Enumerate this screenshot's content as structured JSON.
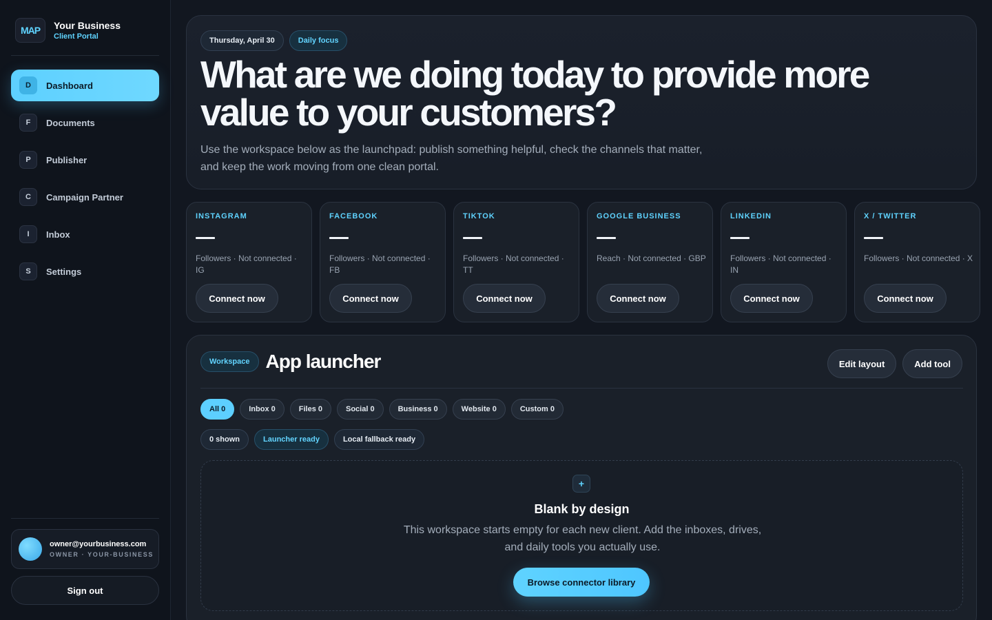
{
  "brand": {
    "logo_text": "MAP",
    "title": "Your Business",
    "subtitle": "Client Portal"
  },
  "sidebar": {
    "items": [
      {
        "letter": "D",
        "label": "Dashboard",
        "active": true
      },
      {
        "letter": "F",
        "label": "Documents"
      },
      {
        "letter": "P",
        "label": "Publisher"
      },
      {
        "letter": "C",
        "label": "Campaign Partner"
      },
      {
        "letter": "I",
        "label": "Inbox"
      },
      {
        "letter": "S",
        "label": "Settings"
      }
    ]
  },
  "user": {
    "email": "owner@yourbusiness.com",
    "role": "OWNER · YOUR-BUSINESS",
    "signout_label": "Sign out"
  },
  "hero": {
    "date": "Thursday, April 30",
    "tag": "Daily focus",
    "title": "What are we doing today to provide more value to your customers?",
    "description": "Use the workspace below as the launchpad: publish something helpful, check the channels that matter, and keep the work moving from one clean portal."
  },
  "channels": [
    {
      "name": "INSTAGRAM",
      "value": "—",
      "meta": "Followers · Not connected · IG",
      "button": "Connect now"
    },
    {
      "name": "FACEBOOK",
      "value": "—",
      "meta": "Followers · Not connected · FB",
      "button": "Connect now"
    },
    {
      "name": "TIKTOK",
      "value": "—",
      "meta": "Followers · Not connected · TT",
      "button": "Connect now"
    },
    {
      "name": "GOOGLE BUSINESS",
      "value": "—",
      "meta": "Reach · Not connected · GBP",
      "button": "Connect now"
    },
    {
      "name": "LINKEDIN",
      "value": "—",
      "meta": "Followers · Not connected · IN",
      "button": "Connect now"
    },
    {
      "name": "X / TWITTER",
      "value": "—",
      "meta": "Followers · Not connected · X",
      "button": "Connect now"
    }
  ],
  "launcher": {
    "tag": "Workspace",
    "title": "App launcher",
    "edit_label": "Edit layout",
    "add_label": "Add tool",
    "filters": [
      "All 0",
      "Inbox 0",
      "Files 0",
      "Social 0",
      "Business 0",
      "Website 0",
      "Custom 0"
    ],
    "statuses": [
      "0 shown",
      "Launcher ready",
      "Local fallback ready"
    ],
    "empty": {
      "icon": "+",
      "title": "Blank by design",
      "description": "This workspace starts empty for each new client. Add the inboxes, drives, and daily tools you actually use.",
      "button": "Browse connector library"
    }
  },
  "colors": {
    "accent": "#5fd3ff",
    "background": "#121720",
    "card": "#1a2029"
  }
}
